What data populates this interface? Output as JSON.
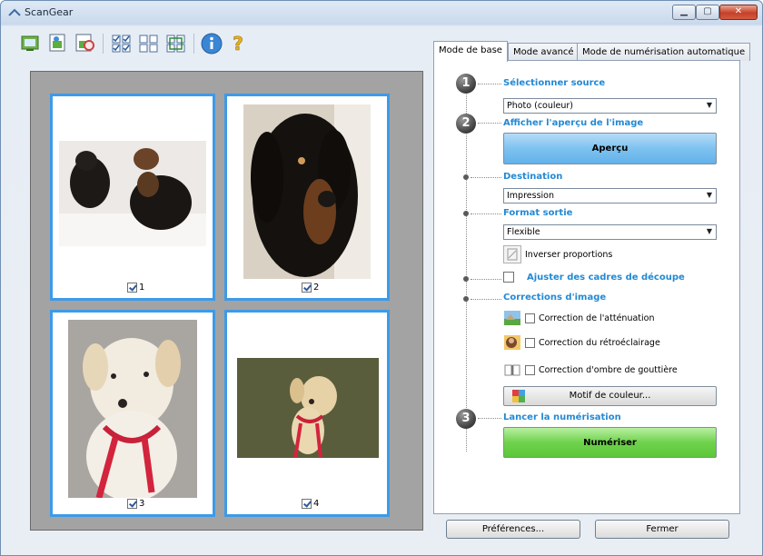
{
  "window": {
    "title": "ScanGear"
  },
  "toolbar": {
    "buttons": [
      "scan-preview-icon",
      "crop-icon",
      "zoom-icon",
      "select-all-frames-icon",
      "thumbnail-view-icon",
      "whole-image-view-icon",
      "info-icon",
      "help-icon"
    ]
  },
  "thumbnails": [
    {
      "label": "1",
      "checked": true
    },
    {
      "label": "2",
      "checked": true
    },
    {
      "label": "3",
      "checked": true
    },
    {
      "label": "4",
      "checked": true
    }
  ],
  "tabs": [
    {
      "label": "Mode de base",
      "active": true
    },
    {
      "label": "Mode avancé",
      "active": false
    },
    {
      "label": "Mode de numérisation automatique",
      "active": false
    }
  ],
  "panel": {
    "step1": {
      "number": "1",
      "heading": "Sélectionner source",
      "select_value": "Photo (couleur)"
    },
    "step2": {
      "number": "2",
      "heading": "Afficher l'aperçu de l'image",
      "preview_button": "Aperçu"
    },
    "destination": {
      "heading": "Destination",
      "select_value": "Impression"
    },
    "format": {
      "heading": "Format sortie",
      "select_value": "Flexible",
      "invert_label": "Inverser proportions"
    },
    "crop": {
      "label": "Ajuster des cadres de découpe"
    },
    "corrections": {
      "heading": "Corrections d'image",
      "items": [
        {
          "label": "Correction de l'atténuation",
          "checked": false
        },
        {
          "label": "Correction du rétroéclairage",
          "checked": false
        },
        {
          "label": "Correction d'ombre de gouttière",
          "checked": false
        }
      ],
      "color_pattern_button": "Motif de couleur..."
    },
    "step3": {
      "number": "3",
      "heading": "Lancer la numérisation",
      "scan_button": "Numériser"
    }
  },
  "footer": {
    "preferences": "Préférences...",
    "close": "Fermer"
  }
}
